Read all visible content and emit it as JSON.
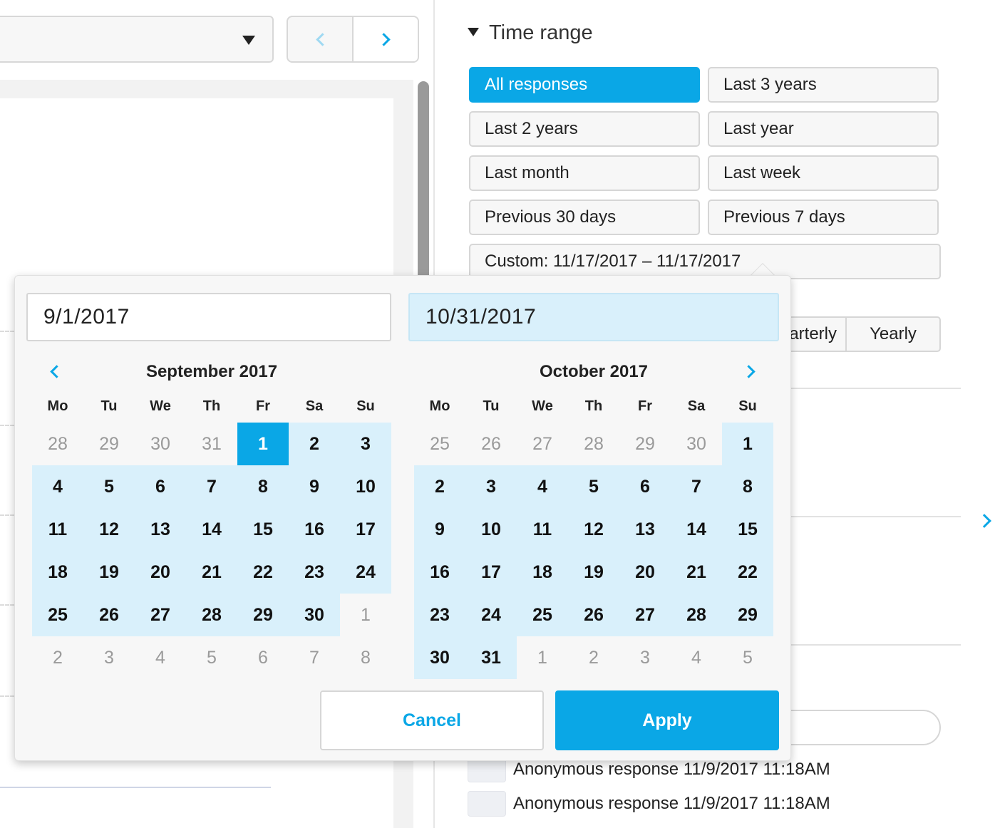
{
  "time_range": {
    "title": "Time range",
    "presets": [
      {
        "label": "All responses",
        "active": true
      },
      {
        "label": "Last 3 years",
        "active": false
      },
      {
        "label": "Last 2 years",
        "active": false
      },
      {
        "label": "Last year",
        "active": false
      },
      {
        "label": "Last month",
        "active": false
      },
      {
        "label": "Last week",
        "active": false
      },
      {
        "label": "Previous 30 days",
        "active": false
      },
      {
        "label": "Previous 7 days",
        "active": false
      }
    ],
    "custom_label": "Custom: 11/17/2017 – 11/17/2017"
  },
  "periods": {
    "quarterly_partial": "arterly",
    "yearly": "Yearly"
  },
  "responses": [
    "Anonymous response 11/9/2017 11:18AM",
    "Anonymous response 11/9/2017 11:18AM"
  ],
  "date_picker": {
    "start_value": "9/1/2017",
    "end_value": "10/31/2017",
    "weekdays": [
      "Mo",
      "Tu",
      "We",
      "Th",
      "Fr",
      "Sa",
      "Su"
    ],
    "calendars": [
      {
        "month": "September 2017",
        "weeks": [
          [
            {
              "d": "28",
              "s": "off"
            },
            {
              "d": "29",
              "s": "off"
            },
            {
              "d": "30",
              "s": "off"
            },
            {
              "d": "31",
              "s": "off"
            },
            {
              "d": "1",
              "s": "sel"
            },
            {
              "d": "2",
              "s": "inrange"
            },
            {
              "d": "3",
              "s": "inrange"
            }
          ],
          [
            {
              "d": "4",
              "s": "inrange"
            },
            {
              "d": "5",
              "s": "inrange"
            },
            {
              "d": "6",
              "s": "inrange"
            },
            {
              "d": "7",
              "s": "inrange"
            },
            {
              "d": "8",
              "s": "inrange"
            },
            {
              "d": "9",
              "s": "inrange"
            },
            {
              "d": "10",
              "s": "inrange"
            }
          ],
          [
            {
              "d": "11",
              "s": "inrange"
            },
            {
              "d": "12",
              "s": "inrange"
            },
            {
              "d": "13",
              "s": "inrange"
            },
            {
              "d": "14",
              "s": "inrange"
            },
            {
              "d": "15",
              "s": "inrange"
            },
            {
              "d": "16",
              "s": "inrange"
            },
            {
              "d": "17",
              "s": "inrange"
            }
          ],
          [
            {
              "d": "18",
              "s": "inrange"
            },
            {
              "d": "19",
              "s": "inrange"
            },
            {
              "d": "20",
              "s": "inrange"
            },
            {
              "d": "21",
              "s": "inrange"
            },
            {
              "d": "22",
              "s": "inrange"
            },
            {
              "d": "23",
              "s": "inrange"
            },
            {
              "d": "24",
              "s": "inrange"
            }
          ],
          [
            {
              "d": "25",
              "s": "inrange"
            },
            {
              "d": "26",
              "s": "inrange"
            },
            {
              "d": "27",
              "s": "inrange"
            },
            {
              "d": "28",
              "s": "inrange"
            },
            {
              "d": "29",
              "s": "inrange"
            },
            {
              "d": "30",
              "s": "inrange"
            },
            {
              "d": "1",
              "s": "off"
            }
          ],
          [
            {
              "d": "2",
              "s": "off"
            },
            {
              "d": "3",
              "s": "off"
            },
            {
              "d": "4",
              "s": "off"
            },
            {
              "d": "5",
              "s": "off"
            },
            {
              "d": "6",
              "s": "off"
            },
            {
              "d": "7",
              "s": "off"
            },
            {
              "d": "8",
              "s": "off"
            }
          ]
        ]
      },
      {
        "month": "October 2017",
        "weeks": [
          [
            {
              "d": "25",
              "s": "off"
            },
            {
              "d": "26",
              "s": "off"
            },
            {
              "d": "27",
              "s": "off"
            },
            {
              "d": "28",
              "s": "off"
            },
            {
              "d": "29",
              "s": "off"
            },
            {
              "d": "30",
              "s": "off"
            },
            {
              "d": "1",
              "s": "inrange"
            }
          ],
          [
            {
              "d": "2",
              "s": "inrange"
            },
            {
              "d": "3",
              "s": "inrange"
            },
            {
              "d": "4",
              "s": "inrange"
            },
            {
              "d": "5",
              "s": "inrange"
            },
            {
              "d": "6",
              "s": "inrange"
            },
            {
              "d": "7",
              "s": "inrange"
            },
            {
              "d": "8",
              "s": "inrange"
            }
          ],
          [
            {
              "d": "9",
              "s": "inrange"
            },
            {
              "d": "10",
              "s": "inrange"
            },
            {
              "d": "11",
              "s": "inrange"
            },
            {
              "d": "12",
              "s": "inrange"
            },
            {
              "d": "13",
              "s": "inrange"
            },
            {
              "d": "14",
              "s": "inrange"
            },
            {
              "d": "15",
              "s": "inrange"
            }
          ],
          [
            {
              "d": "16",
              "s": "inrange"
            },
            {
              "d": "17",
              "s": "inrange"
            },
            {
              "d": "18",
              "s": "inrange"
            },
            {
              "d": "19",
              "s": "inrange"
            },
            {
              "d": "20",
              "s": "inrange"
            },
            {
              "d": "21",
              "s": "inrange"
            },
            {
              "d": "22",
              "s": "inrange"
            }
          ],
          [
            {
              "d": "23",
              "s": "inrange"
            },
            {
              "d": "24",
              "s": "inrange"
            },
            {
              "d": "25",
              "s": "inrange"
            },
            {
              "d": "26",
              "s": "inrange"
            },
            {
              "d": "27",
              "s": "inrange"
            },
            {
              "d": "28",
              "s": "inrange"
            },
            {
              "d": "29",
              "s": "inrange"
            }
          ],
          [
            {
              "d": "30",
              "s": "inrange"
            },
            {
              "d": "31",
              "s": "inrange"
            },
            {
              "d": "1",
              "s": "off"
            },
            {
              "d": "2",
              "s": "off"
            },
            {
              "d": "3",
              "s": "off"
            },
            {
              "d": "4",
              "s": "off"
            },
            {
              "d": "5",
              "s": "off"
            }
          ]
        ]
      }
    ],
    "cancel_label": "Cancel",
    "apply_label": "Apply"
  },
  "colors": {
    "accent": "#0aa7e6",
    "range_fill": "#d9f0fb",
    "popup_bg": "#f7f7f7"
  }
}
